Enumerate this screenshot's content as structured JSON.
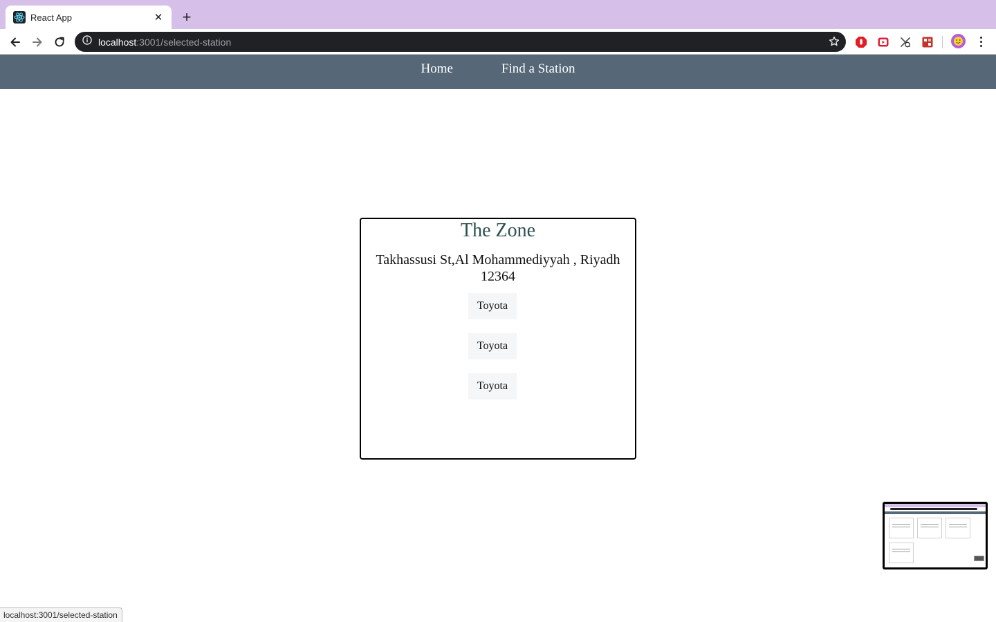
{
  "browser": {
    "tab_title": "React App",
    "url_host": "localhost",
    "url_path": ":3001/selected-station",
    "status_url": "localhost:3001/selected-station",
    "colors": {
      "tabstrip": "#d6c0ea",
      "omnibox": "#202124"
    }
  },
  "nav": {
    "home_label": "Home",
    "find_label": "Find a Station",
    "background": "#566778"
  },
  "station": {
    "name": "The Zone",
    "address": "Takhassusi St,Al Mohammediyyah , Riyadh 12364",
    "cars": [
      "Toyota",
      "Toyota",
      "Toyota"
    ],
    "name_color": "#2c5150"
  },
  "icons": {
    "favicon": "react-icon",
    "back": "arrow-left-icon",
    "forward": "arrow-right-icon",
    "reload": "reload-icon",
    "info": "info-icon",
    "bookmark": "star-icon",
    "menu": "kebab-menu-icon"
  }
}
